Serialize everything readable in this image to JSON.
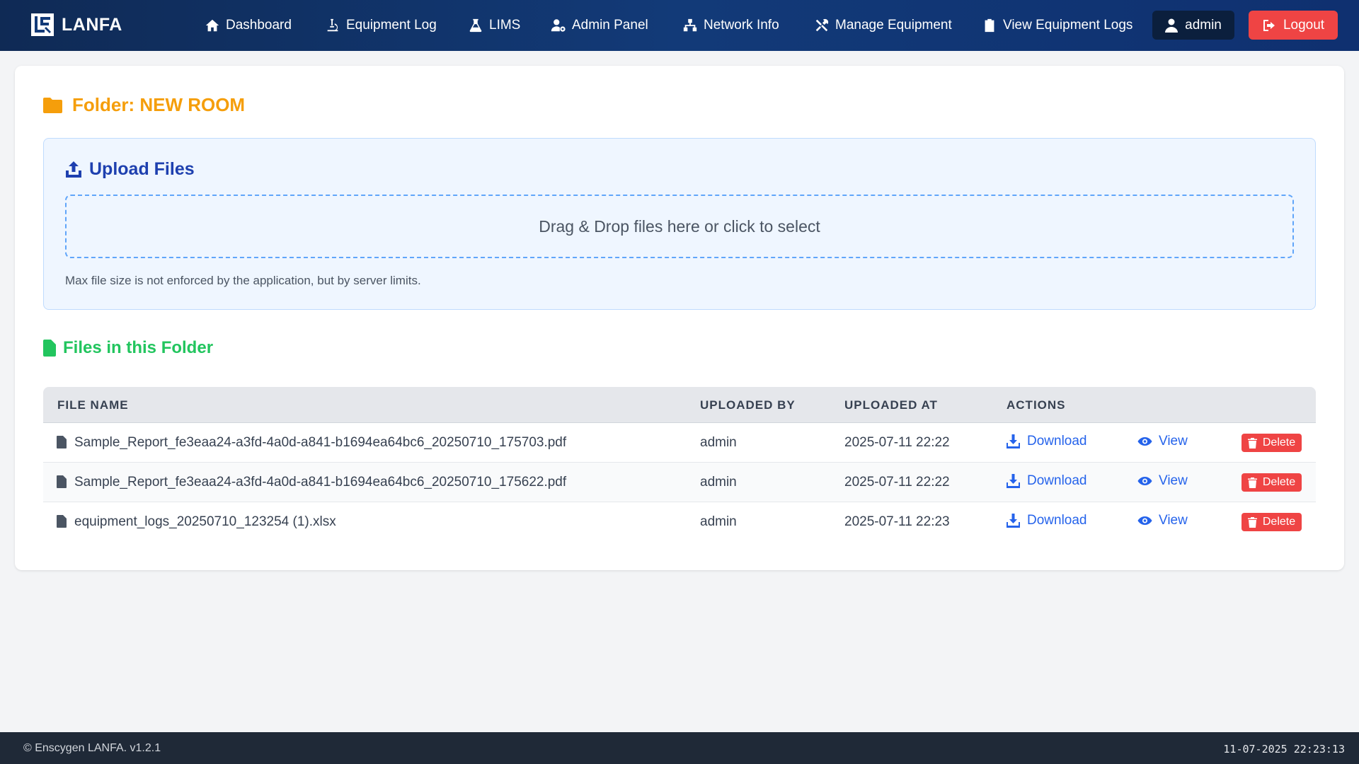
{
  "brand": {
    "name": "LANFA"
  },
  "nav": {
    "items": [
      {
        "label": "Dashboard",
        "icon": "home-icon"
      },
      {
        "label": "Equipment Log",
        "icon": "microscope-icon"
      },
      {
        "label": "LIMS",
        "icon": "flask-icon"
      },
      {
        "label": "Admin Panel",
        "icon": "user-gear-icon"
      },
      {
        "label": "Network Info",
        "icon": "network-icon"
      },
      {
        "label": "Manage Equipment",
        "icon": "tools-icon"
      },
      {
        "label": "View Equipment Logs",
        "icon": "clipboard-icon"
      }
    ],
    "user_label": "admin",
    "logout_label": "Logout"
  },
  "folder": {
    "title": "Folder: NEW ROOM"
  },
  "upload": {
    "title": "Upload Files",
    "dropzone_text": "Drag & Drop files here or click to select",
    "note": "Max file size is not enforced by the application, but by server limits."
  },
  "files": {
    "title": "Files in this Folder",
    "columns": [
      "FILE NAME",
      "UPLOADED BY",
      "UPLOADED AT",
      "ACTIONS"
    ],
    "rows": [
      {
        "name": "Sample_Report_fe3eaa24-a3fd-4a0d-a841-b1694ea64bc6_20250710_175703.pdf",
        "uploaded_by": "admin",
        "uploaded_at": "2025-07-11 22:22"
      },
      {
        "name": "Sample_Report_fe3eaa24-a3fd-4a0d-a841-b1694ea64bc6_20250710_175622.pdf",
        "uploaded_by": "admin",
        "uploaded_at": "2025-07-11 22:22"
      },
      {
        "name": "equipment_logs_20250710_123254 (1).xlsx",
        "uploaded_by": "admin",
        "uploaded_at": "2025-07-11 22:23"
      }
    ],
    "actions": {
      "download": "Download",
      "view": "View",
      "delete": "Delete"
    }
  },
  "footer": {
    "copyright": "© Enscygen LANFA. v1.2.1",
    "clock": "11-07-2025 22:23:13"
  },
  "colors": {
    "navbar": "#0f2a55",
    "folder_accent": "#f59e0b",
    "upload_accent": "#1e40af",
    "files_accent": "#22c55e",
    "link": "#2563eb",
    "danger": "#ef4444"
  }
}
